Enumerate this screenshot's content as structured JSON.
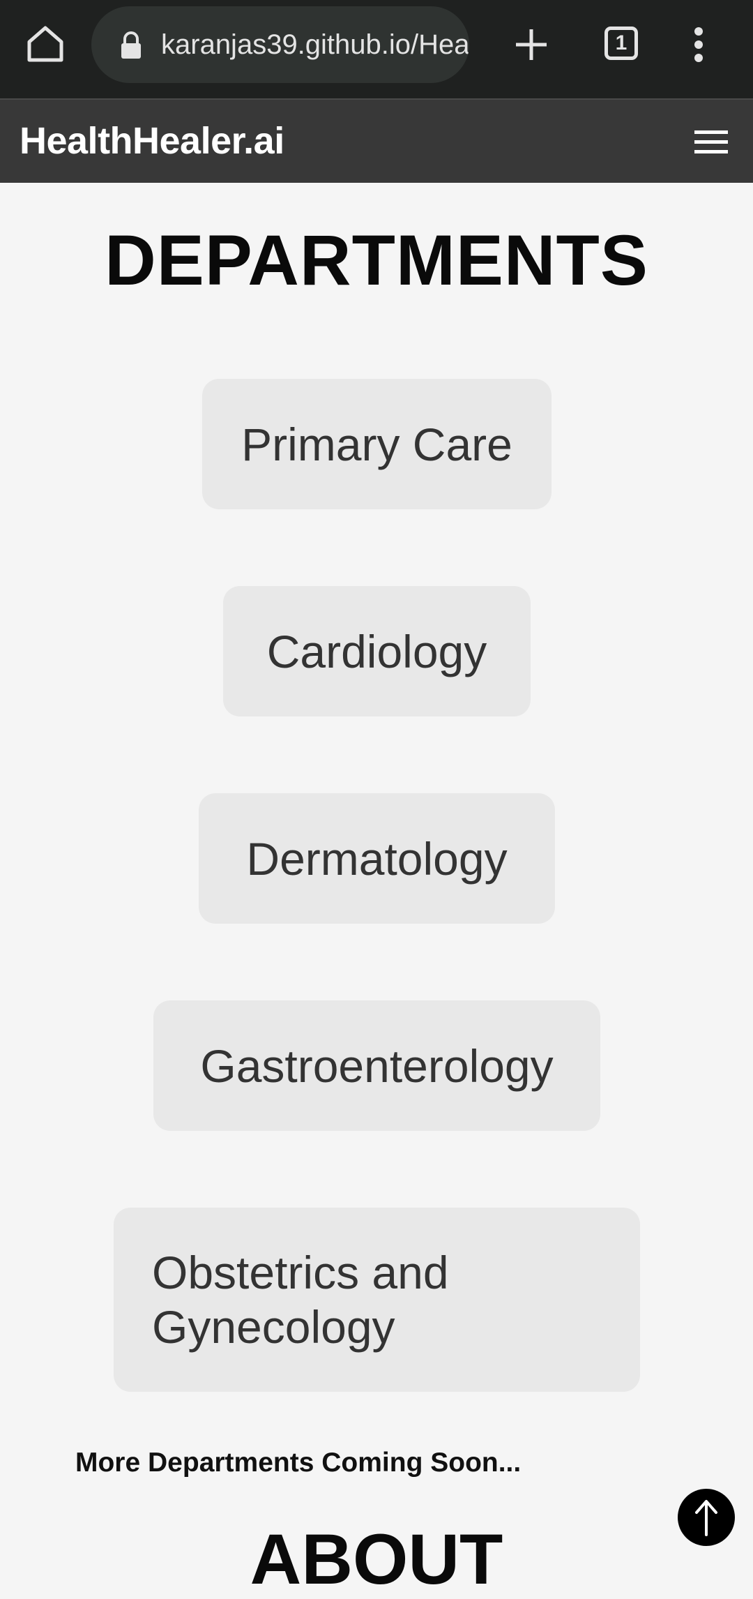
{
  "browser": {
    "url": "karanjas39.github.io/Hea",
    "tab_count": "1"
  },
  "navbar": {
    "brand": "HealthHealer.ai"
  },
  "departments": {
    "title": "DEPARTMENTS",
    "items": [
      {
        "label": "Primary Care"
      },
      {
        "label": "Cardiology"
      },
      {
        "label": "Dermatology"
      },
      {
        "label": "Gastroenterology"
      },
      {
        "label": "Obstetrics and Gynecology"
      }
    ],
    "footer_note": "More Departments Coming Soon..."
  },
  "about": {
    "title": "ABOUT"
  },
  "icons": {
    "home": "home-icon",
    "lock": "lock-icon",
    "new_tab": "plus-icon",
    "tabs": "tab-switcher-icon",
    "menu": "more-vert-icon",
    "hamburger": "hamburger-menu-icon",
    "scroll_top": "arrow-up-icon"
  },
  "colors": {
    "browser_bar": "#1f2120",
    "navbar": "#383838",
    "page_bg": "#f5f5f5",
    "button_bg": "#e8e8e8"
  }
}
